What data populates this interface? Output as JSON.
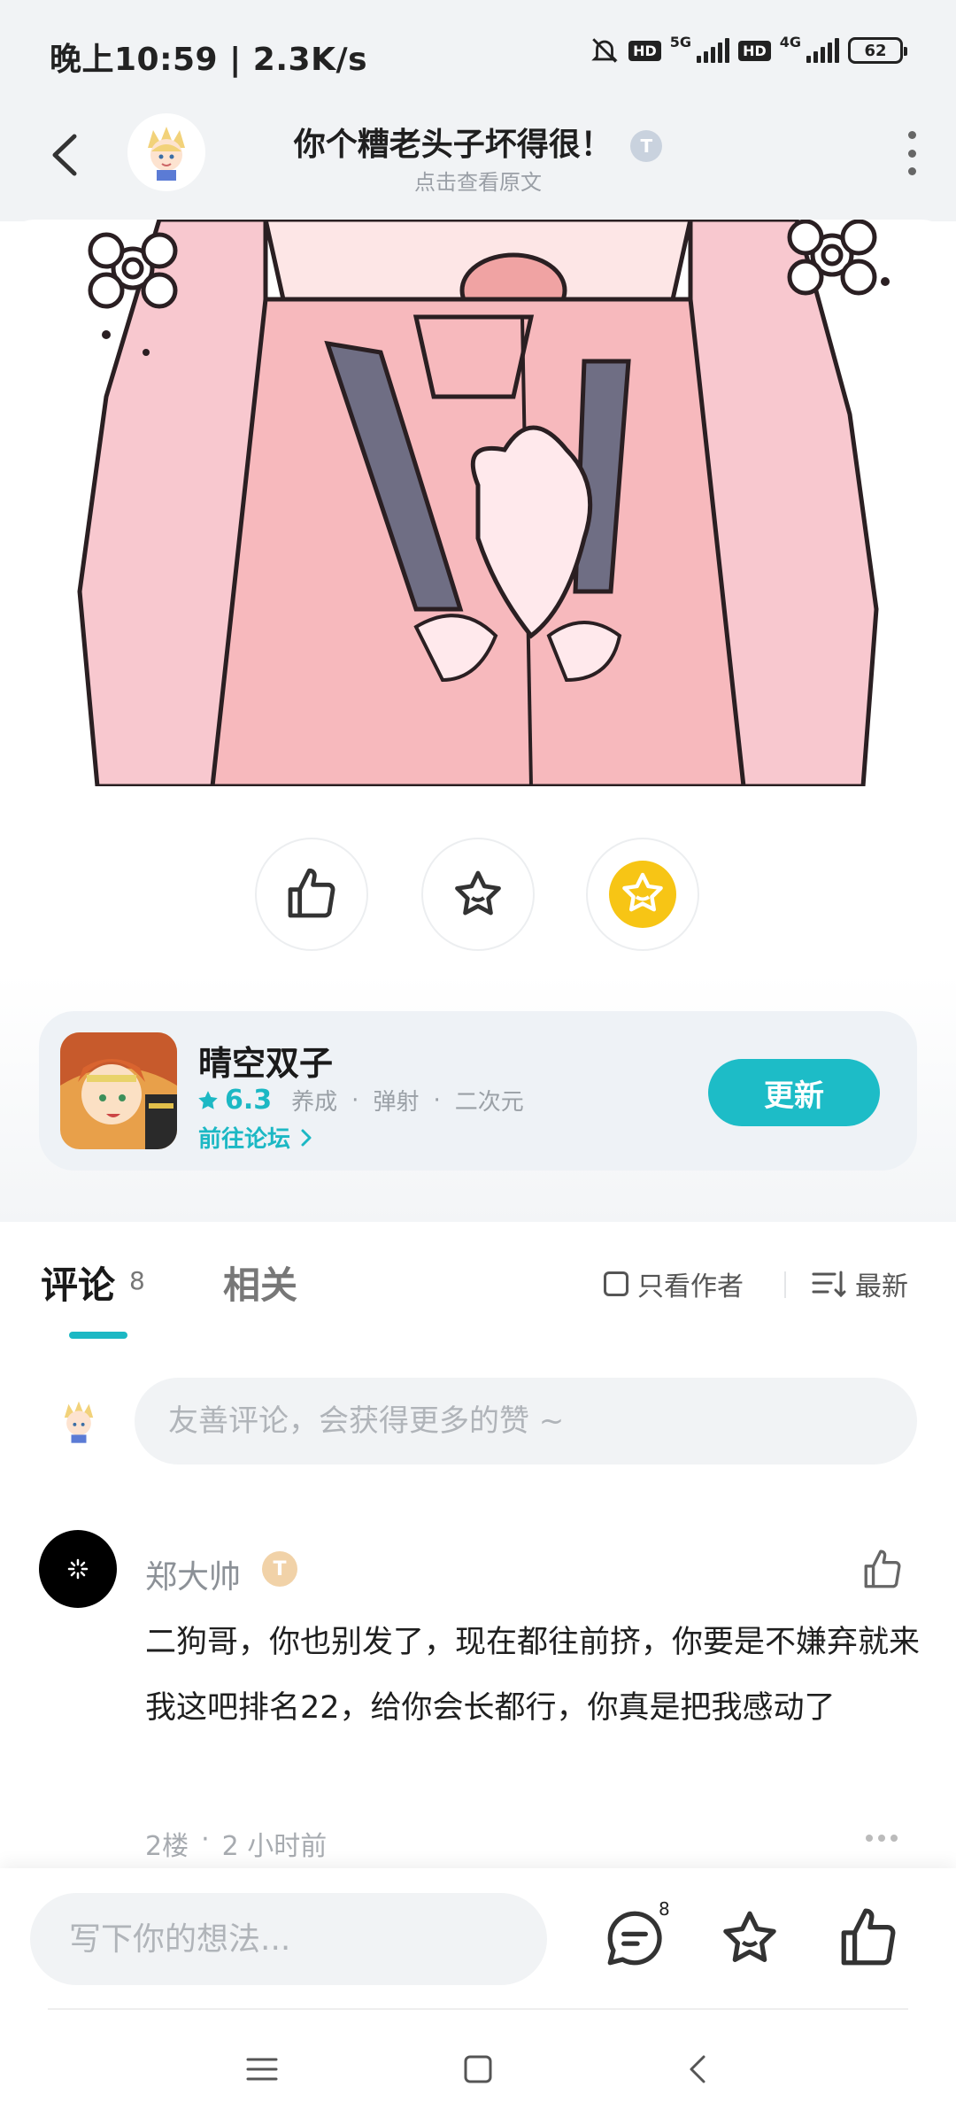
{
  "status_bar": {
    "time_speed": "晚上10:59 | 2.3K/s",
    "hd_label": "HD",
    "net1": "5G",
    "net2": "4G",
    "battery": "62"
  },
  "header": {
    "title": "你个糟老头子坏得很！",
    "title_badge": "T",
    "subtitle": "点击查看原文"
  },
  "game": {
    "name": "晴空双子",
    "rating": "6.3",
    "tags": [
      "养成",
      "弹射",
      "二次元"
    ],
    "forum_link": "前往论坛",
    "update_label": "更新",
    "accent_color": "#1cb8c4"
  },
  "tabs": {
    "comments_label": "评论",
    "comments_count": "8",
    "related_label": "相关",
    "only_author_label": "只看作者",
    "sort_label": "最新"
  },
  "comment_input": {
    "placeholder": "友善评论，会获得更多的赞 ~"
  },
  "comments": [
    {
      "user": "郑大帅",
      "badge": "T",
      "text": "二狗哥，你也别发了，现在都往前挤，你要是不嫌弃就来我这吧排名22，给你会长都行，你真是把我感动了",
      "floor": "2楼",
      "time": "2 小时前"
    }
  ],
  "bottom_bar": {
    "placeholder": "写下你的想法...",
    "comment_count": "8"
  },
  "icons": {
    "back": "chevron-left-icon",
    "more": "more-vertical-icon",
    "like": "thumbs-up-icon",
    "favorite": "star-icon",
    "reward": "gold-star-icon",
    "comment": "chat-bubble-icon",
    "nav_menu": "menu-icon",
    "nav_home": "square-icon",
    "nav_back": "triangle-back-icon"
  }
}
